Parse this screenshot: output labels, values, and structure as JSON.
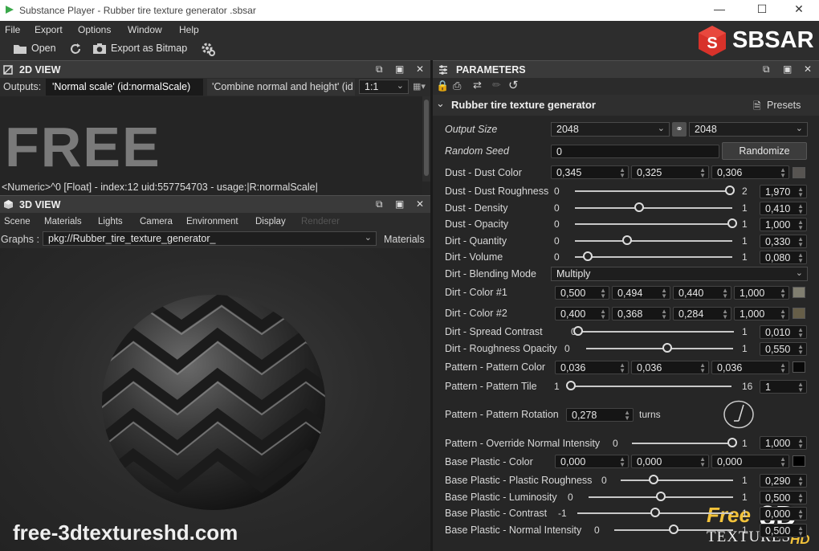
{
  "window": {
    "title": "Substance Player - Rubber tire texture generator .sbsar"
  },
  "menu": [
    "File",
    "Export",
    "Options",
    "Window",
    "Help"
  ],
  "toolbar": {
    "open": "Open",
    "export": "Export as Bitmap"
  },
  "logo": {
    "text": "SBSAR"
  },
  "view2d": {
    "title": "2D VIEW",
    "outputs_label": "Outputs:",
    "tab1": "'Normal scale' (id:normalScale)",
    "tab2": "'Combine normal and height' (id",
    "zoom": "1:1",
    "free_text": "FREE",
    "info": "<Numeric>^0 [Float] - index:12 uid:557754703 - usage:|R:normalScale|"
  },
  "view3d": {
    "title": "3D VIEW",
    "tabs": [
      "Scene",
      "Materials",
      "Lights",
      "Camera",
      "Environment",
      "Display",
      "Renderer"
    ],
    "graphs_label": "Graphs :",
    "graph_value": "pkg://Rubber_tire_texture_generator_",
    "materials_button": "Materials"
  },
  "watermark": {
    "site": "free-3dtextureshd.com",
    "badge_free": "Free",
    "badge_3d": "3D",
    "badge_textures": "TEXTURES",
    "badge_hd": "HD"
  },
  "params": {
    "title": "PARAMETERS",
    "section": "Rubber tire texture generator",
    "presets": "Presets",
    "output_size": {
      "label": "Output Size",
      "a": "2048",
      "b": "2048"
    },
    "random_seed": {
      "label": "Random Seed",
      "value": "0",
      "button": "Randomize"
    },
    "dust_color": {
      "label": "Dust - Dust Color",
      "v": [
        "0,345",
        "0,325",
        "0,306"
      ],
      "swatch": "#575451"
    },
    "sliders": [
      {
        "label": "Dust - Dust Roughness",
        "min": "0",
        "max": "2",
        "value": "1,970",
        "frac": 0.985
      },
      {
        "label": "Dust - Density",
        "min": "0",
        "max": "1",
        "value": "0,410",
        "frac": 0.41
      },
      {
        "label": "Dust - Opacity",
        "min": "0",
        "max": "1",
        "value": "1,000",
        "frac": 1.0
      },
      {
        "label": "Dirt - Quantity",
        "min": "0",
        "max": "1",
        "value": "0,330",
        "frac": 0.33
      },
      {
        "label": "Dirt - Volume",
        "min": "0",
        "max": "1",
        "value": "0,080",
        "frac": 0.08
      }
    ],
    "blend": {
      "label": "Dirt - Blending Mode",
      "value": "Multiply"
    },
    "dirt_color1": {
      "label": "Dirt - Color #1",
      "v": [
        "0,500",
        "0,494",
        "0,440",
        "1,000"
      ],
      "swatch": "#807e70"
    },
    "dirt_color2": {
      "label": "Dirt - Color #2",
      "v": [
        "0,400",
        "0,368",
        "0,284",
        "1,000"
      ],
      "swatch": "#665e48"
    },
    "sliders2": [
      {
        "label": "Dirt - Spread Contrast",
        "min": "0",
        "max": "1",
        "value": "0,010",
        "frac": 0.01
      },
      {
        "label": "Dirt - Roughness Opacity",
        "min": "0",
        "max": "1",
        "value": "0,550",
        "frac": 0.55
      }
    ],
    "pattern_color": {
      "label": "Pattern - Pattern Color",
      "v": [
        "0,036",
        "0,036",
        "0,036"
      ],
      "swatch": "#090909"
    },
    "pattern_tile": {
      "label": "Pattern - Pattern Tile",
      "min": "1",
      "max": "16",
      "value": "1",
      "frac": 0.0
    },
    "pattern_rotation": {
      "label": "Pattern - Pattern Rotation",
      "value": "0,278",
      "unit": "turns"
    },
    "override_normal": {
      "label": "Pattern - Override Normal Intensity",
      "min": "0",
      "max": "1",
      "value": "1,000",
      "frac": 1.0
    },
    "base_color": {
      "label": "Base Plastic  - Color",
      "v": [
        "0,000",
        "0,000",
        "0,000"
      ],
      "swatch": "#000000"
    },
    "sliders3": [
      {
        "label": "Base Plastic  - Plastic Roughness",
        "min": "0",
        "max": "1",
        "value": "0,290",
        "frac": 0.29
      },
      {
        "label": "Base Plastic  - Luminosity",
        "min": "0",
        "max": "1",
        "value": "0,500",
        "frac": 0.5
      },
      {
        "label": "Base Plastic  - Contrast",
        "min": "-1",
        "max": "1",
        "value": "0,000",
        "frac": 0.5
      },
      {
        "label": "Base Plastic  - Normal Intensity",
        "min": "0",
        "max": "1",
        "value": "0,500",
        "frac": 0.5
      }
    ]
  }
}
